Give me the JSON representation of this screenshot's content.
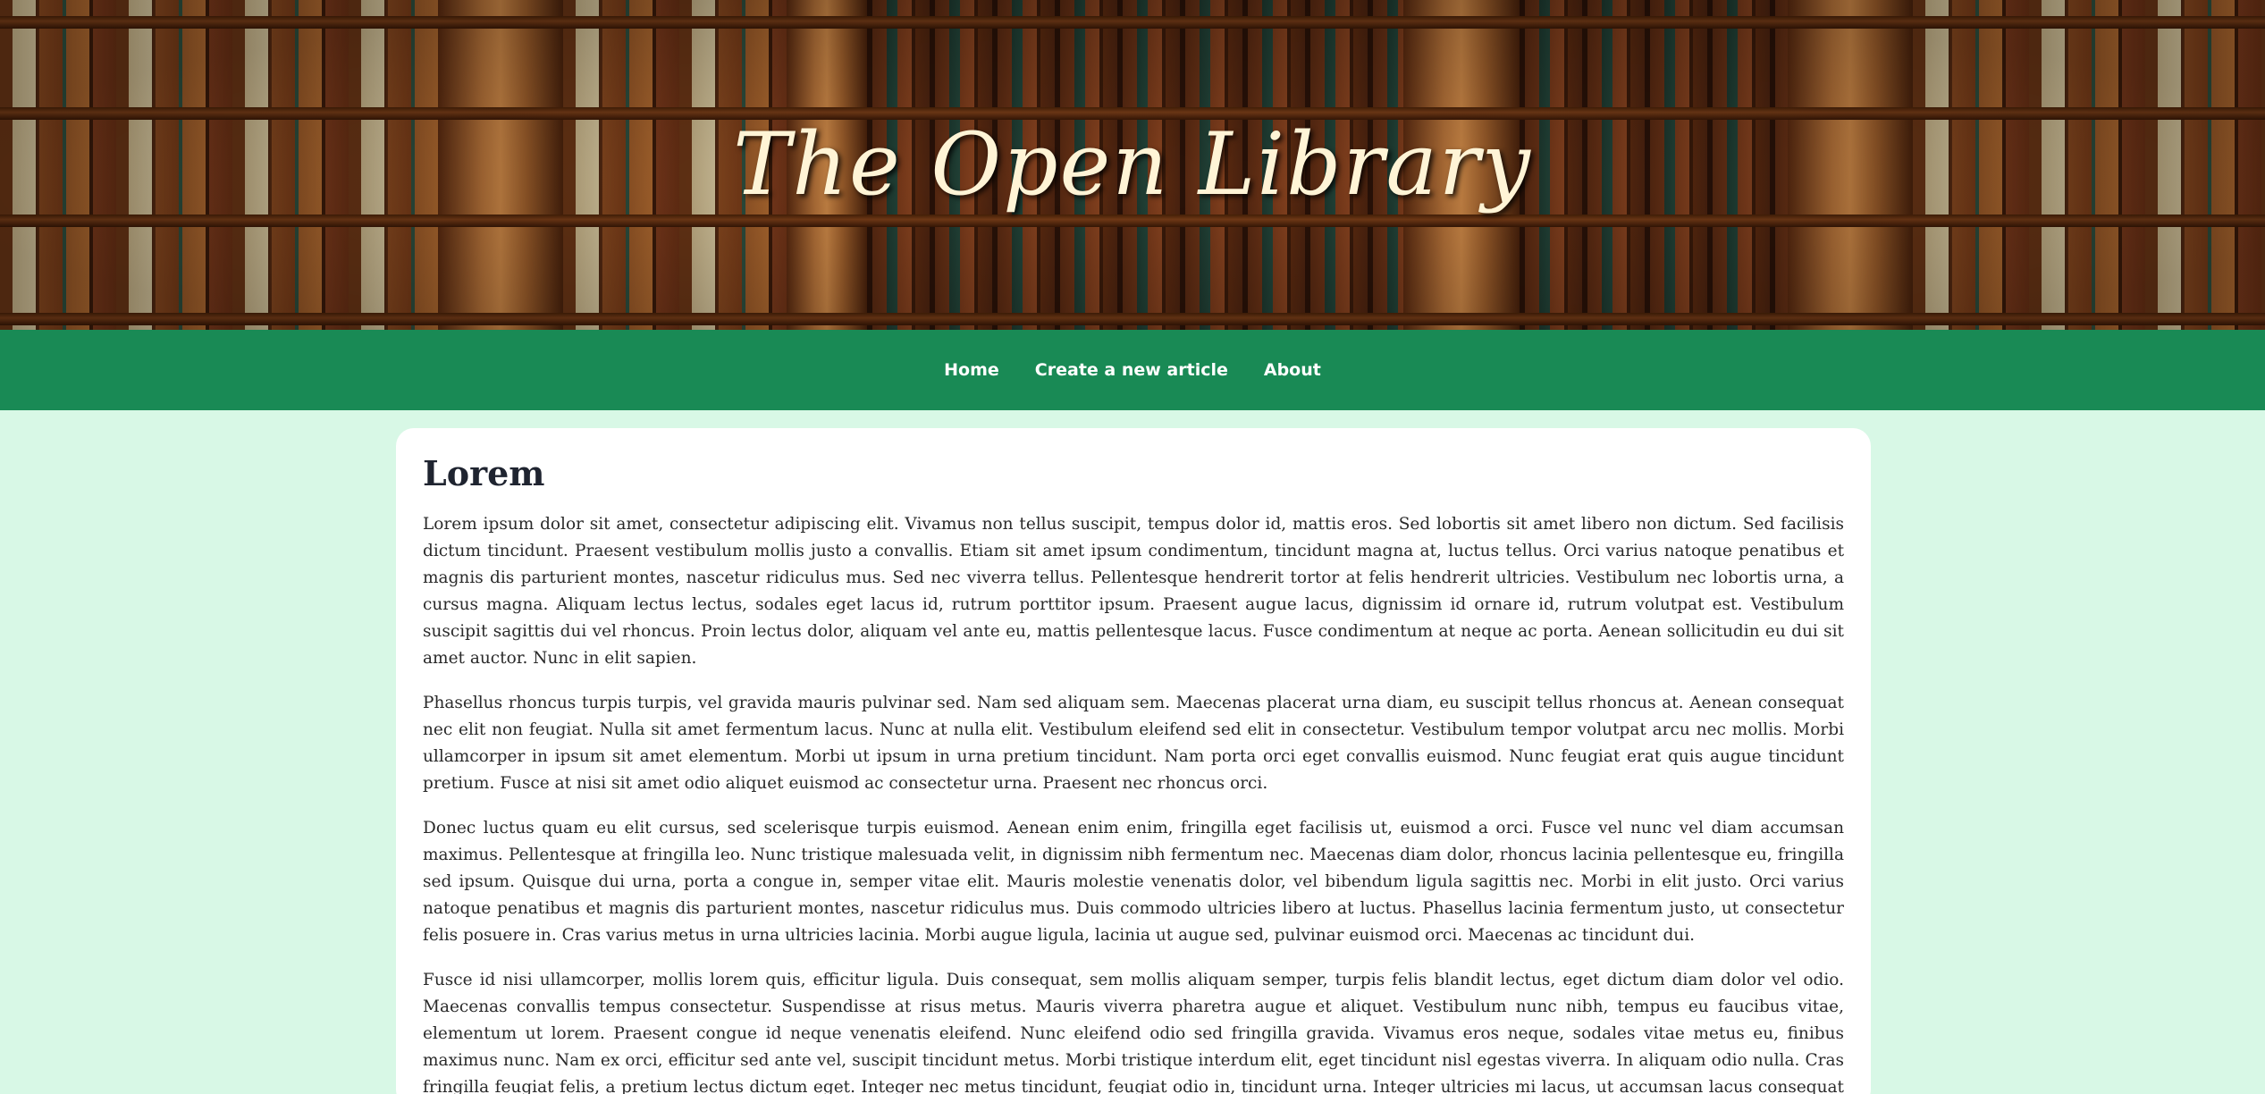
{
  "header": {
    "site_title": "The Open Library"
  },
  "nav": {
    "items": [
      {
        "label": "Home"
      },
      {
        "label": "Create a new article"
      },
      {
        "label": "About"
      }
    ]
  },
  "article": {
    "title": "Lorem",
    "paragraphs": [
      "Lorem ipsum dolor sit amet, consectetur adipiscing elit. Vivamus non tellus suscipit, tempus dolor id, mattis eros. Sed lobortis sit amet libero non dictum. Sed facilisis dictum tincidunt. Praesent vestibulum mollis justo a convallis. Etiam sit amet ipsum condimentum, tincidunt magna at, luctus tellus. Orci varius natoque penatibus et magnis dis parturient montes, nascetur ridiculus mus. Sed nec viverra tellus. Pellentesque hendrerit tortor at felis hendrerit ultricies. Vestibulum nec lobortis urna, a cursus magna. Aliquam lectus lectus, sodales eget lacus id, rutrum porttitor ipsum. Praesent augue lacus, dignissim id ornare id, rutrum volutpat est. Vestibulum suscipit sagittis dui vel rhoncus. Proin lectus dolor, aliquam vel ante eu, mattis pellentesque lacus. Fusce condimentum at neque ac porta. Aenean sollicitudin eu dui sit amet auctor. Nunc in elit sapien.",
      "Phasellus rhoncus turpis turpis, vel gravida mauris pulvinar sed. Nam sed aliquam sem. Maecenas placerat urna diam, eu suscipit tellus rhoncus at. Aenean consequat nec elit non feugiat. Nulla sit amet fermentum lacus. Nunc at nulla elit. Vestibulum eleifend sed elit in consectetur. Vestibulum tempor volutpat arcu nec mollis. Morbi ullamcorper in ipsum sit amet elementum. Morbi ut ipsum in urna pretium tincidunt. Nam porta orci eget convallis euismod. Nunc feugiat erat quis augue tincidunt pretium. Fusce at nisi sit amet odio aliquet euismod ac consectetur urna. Praesent nec rhoncus orci.",
      "Donec luctus quam eu elit cursus, sed scelerisque turpis euismod. Aenean enim enim, fringilla eget facilisis ut, euismod a orci. Fusce vel nunc vel diam accumsan maximus. Pellentesque at fringilla leo. Nunc tristique malesuada velit, in dignissim nibh fermentum nec. Maecenas diam dolor, rhoncus lacinia pellentesque eu, fringilla sed ipsum. Quisque dui urna, porta a congue in, semper vitae elit. Mauris molestie venenatis dolor, vel bibendum ligula sagittis nec. Morbi in elit justo. Orci varius natoque penatibus et magnis dis parturient montes, nascetur ridiculus mus. Duis commodo ultricies libero at luctus. Phasellus lacinia fermentum justo, ut consectetur felis posuere in. Cras varius metus in urna ultricies lacinia. Morbi augue ligula, lacinia ut augue sed, pulvinar euismod orci. Maecenas ac tincidunt dui.",
      "Fusce id nisi ullamcorper, mollis lorem quis, efficitur ligula. Duis consequat, sem mollis aliquam semper, turpis felis blandit lectus, eget dictum diam dolor vel odio. Maecenas convallis tempus consectetur. Suspendisse at risus metus. Mauris viverra pharetra augue et aliquet. Vestibulum nunc nibh, tempus eu faucibus vitae, elementum ut lorem. Praesent congue id neque venenatis eleifend. Nunc eleifend odio sed fringilla gravida. Vivamus eros neque, sodales vitae metus eu, finibus maximus nunc. Nam ex orci, efficitur sed ante vel, suscipit tincidunt metus. Morbi tristique interdum elit, eget tincidunt nisl egestas viverra. In aliquam odio nulla. Cras fringilla feugiat felis, a pretium lectus dictum eget. Integer nec metus tincidunt, feugiat odio in, tincidunt urna. Integer ultricies mi lacus, ut accumsan lacus consequat id. Donec tristique ornare feugiat."
    ]
  },
  "colors": {
    "page_background": "#d8f8e6",
    "nav_background": "#198a55",
    "card_background": "#ffffff",
    "title_text": "#fff4d6"
  }
}
